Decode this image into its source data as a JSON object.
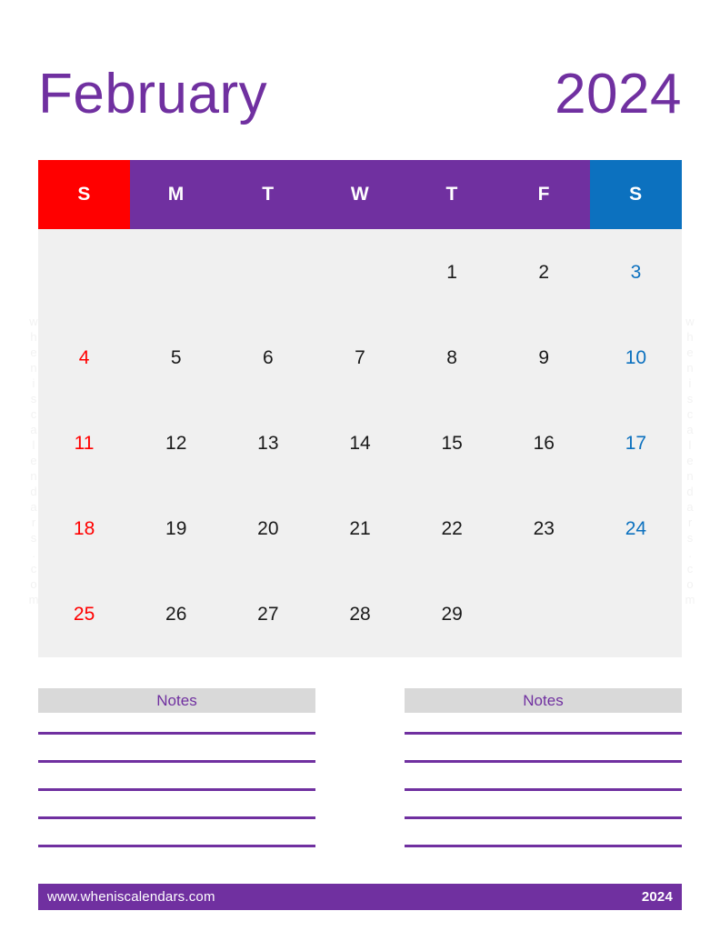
{
  "header": {
    "month": "February",
    "year": "2024",
    "accent_purple": "#7030A0",
    "sunday_red": "#FF0000",
    "saturday_blue": "#0C71BF"
  },
  "watermark": {
    "text": "wheniscalendars.com"
  },
  "calendar": {
    "weekday_headers": [
      {
        "label": "S",
        "kind": "sun"
      },
      {
        "label": "M",
        "kind": "wd"
      },
      {
        "label": "T",
        "kind": "wd"
      },
      {
        "label": "W",
        "kind": "wd"
      },
      {
        "label": "T",
        "kind": "wd"
      },
      {
        "label": "F",
        "kind": "wd"
      },
      {
        "label": "S",
        "kind": "sat"
      }
    ],
    "weeks": [
      [
        {
          "day": "",
          "kind": "empty"
        },
        {
          "day": "",
          "kind": "empty"
        },
        {
          "day": "",
          "kind": "empty"
        },
        {
          "day": "",
          "kind": "empty"
        },
        {
          "day": "1",
          "kind": "wd"
        },
        {
          "day": "2",
          "kind": "wd"
        },
        {
          "day": "3",
          "kind": "sat"
        }
      ],
      [
        {
          "day": "4",
          "kind": "sun"
        },
        {
          "day": "5",
          "kind": "wd"
        },
        {
          "day": "6",
          "kind": "wd"
        },
        {
          "day": "7",
          "kind": "wd"
        },
        {
          "day": "8",
          "kind": "wd"
        },
        {
          "day": "9",
          "kind": "wd"
        },
        {
          "day": "10",
          "kind": "sat"
        }
      ],
      [
        {
          "day": "11",
          "kind": "sun"
        },
        {
          "day": "12",
          "kind": "wd"
        },
        {
          "day": "13",
          "kind": "wd"
        },
        {
          "day": "14",
          "kind": "wd"
        },
        {
          "day": "15",
          "kind": "wd"
        },
        {
          "day": "16",
          "kind": "wd"
        },
        {
          "day": "17",
          "kind": "sat"
        }
      ],
      [
        {
          "day": "18",
          "kind": "sun"
        },
        {
          "day": "19",
          "kind": "wd"
        },
        {
          "day": "20",
          "kind": "wd"
        },
        {
          "day": "21",
          "kind": "wd"
        },
        {
          "day": "22",
          "kind": "wd"
        },
        {
          "day": "23",
          "kind": "wd"
        },
        {
          "day": "24",
          "kind": "sat"
        }
      ],
      [
        {
          "day": "25",
          "kind": "sun"
        },
        {
          "day": "26",
          "kind": "wd"
        },
        {
          "day": "27",
          "kind": "wd"
        },
        {
          "day": "28",
          "kind": "wd"
        },
        {
          "day": "29",
          "kind": "wd"
        },
        {
          "day": "",
          "kind": "empty"
        },
        {
          "day": "",
          "kind": "empty"
        }
      ]
    ]
  },
  "notes": {
    "columns": [
      {
        "title": "Notes",
        "line_count": 5
      },
      {
        "title": "Notes",
        "line_count": 5
      }
    ]
  },
  "footer": {
    "url": "www.wheniscalendars.com",
    "year": "2024"
  }
}
